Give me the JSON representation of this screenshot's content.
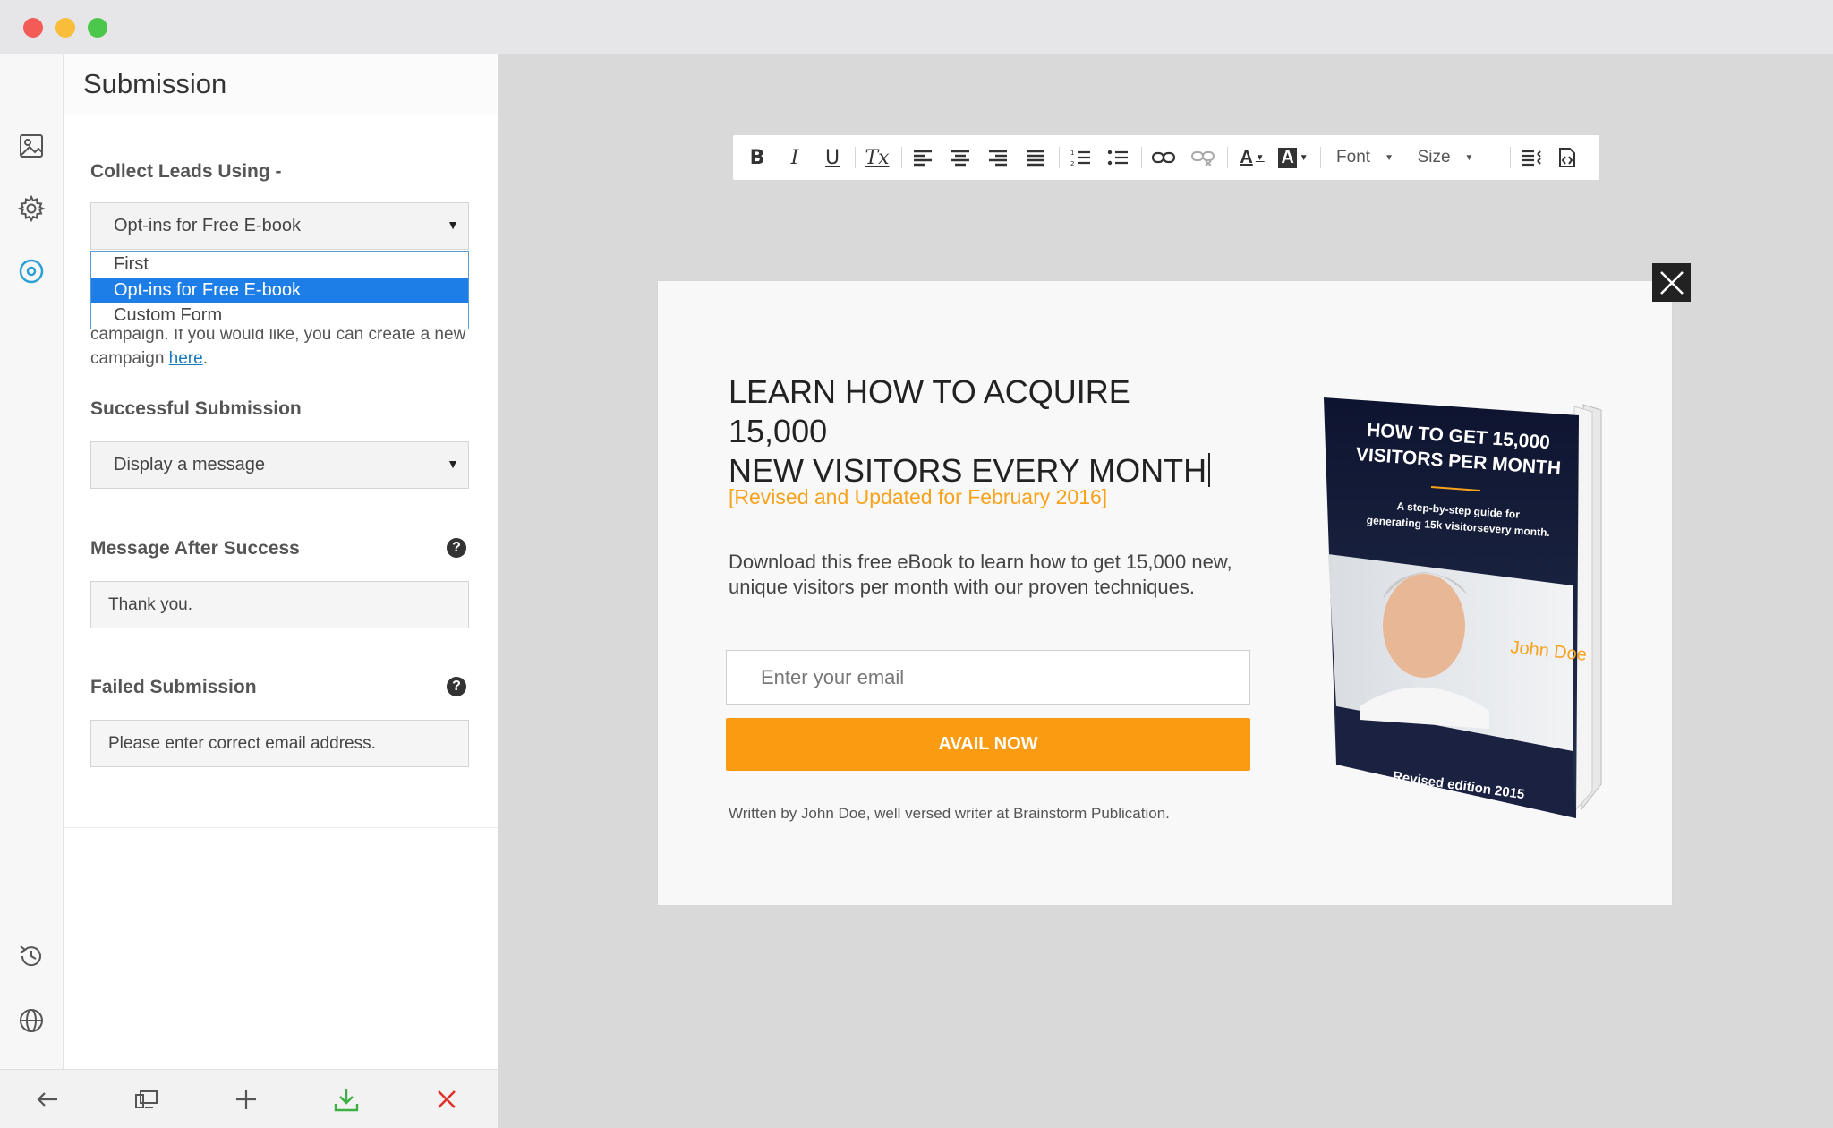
{
  "window": {
    "controls": [
      "close",
      "minimize",
      "maximize"
    ]
  },
  "rail": {
    "icons": [
      "image-icon",
      "gear-icon",
      "target-icon",
      "history-icon",
      "globe-icon"
    ]
  },
  "panel": {
    "title": "Submission",
    "collect_leads": {
      "label": "Collect Leads Using -",
      "selected": "Opt-ins for Free E-book",
      "options": [
        "First",
        "Opt-ins for Free E-book",
        "Custom Form"
      ]
    },
    "note": {
      "text": "campaign. If you would like, you can create a new campaign ",
      "link": "here",
      "after": "."
    },
    "successful_submission": {
      "label": "Successful Submission",
      "selected": "Display a message"
    },
    "message_after_success": {
      "label": "Message After Success",
      "help": "?",
      "value": "Thank you."
    },
    "failed_submission": {
      "label": "Failed Submission",
      "help": "?",
      "value": "Please enter correct email address."
    }
  },
  "bottombar": {
    "icons": [
      "back-arrow-icon",
      "devices-icon",
      "plus-icon",
      "download-icon",
      "close-icon"
    ]
  },
  "toolbar": {
    "bold": "B",
    "italic": "I",
    "underline": "U",
    "clear_format": "Tx",
    "font_label": "Font",
    "size_label": "Size",
    "font_color": "A",
    "bg_color": "A"
  },
  "popup": {
    "headline_line1": "LEARN HOW TO ACQUIRE 15,000",
    "headline_line2": "NEW VISITORS EVERY MONTH",
    "subhead": "[Revised and Updated for February 2016]",
    "description": "Download this free eBook to learn how to get 15,000 new, unique visitors per month with our proven techniques.",
    "email_placeholder": "Enter your email",
    "button": "AVAIL NOW",
    "byline": "Written by John Doe, well versed writer at Brainstorm Publication.",
    "book": {
      "title_line1": "HOW TO GET 15,000",
      "title_line2": "VISITORS PER MONTH",
      "tagline_line1": "A step-by-step guide for",
      "tagline_line2": "generating 15k visitorsevery month.",
      "author": "John Doe",
      "edition": "Revised edition 2015"
    }
  },
  "colors": {
    "accent": "#fb9b12",
    "subhead": "#f7a21b",
    "selection": "#1e7ee8",
    "rail_active": "#2a9fd6",
    "download": "#3cb043",
    "close": "#e0312b"
  }
}
